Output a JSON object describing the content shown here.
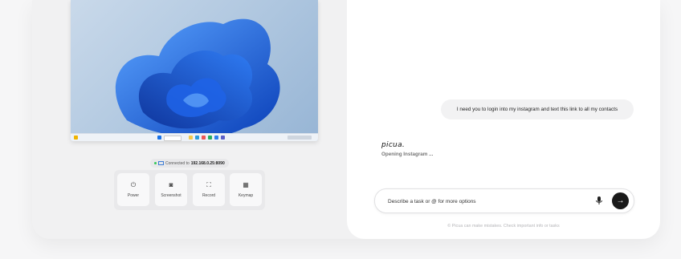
{
  "remote": {
    "connection_prefix": "Connected to",
    "ip": "192.168.0.25:8090",
    "taskbar_search": "Search"
  },
  "controls": [
    {
      "label": "Power",
      "icon": "power-icon",
      "glyph": "⏻"
    },
    {
      "label": "Screenshot",
      "icon": "camera-icon",
      "glyph": "◙"
    },
    {
      "label": "Record",
      "icon": "record-icon",
      "glyph": "⛶"
    },
    {
      "label": "Keymap",
      "icon": "keymap-icon",
      "glyph": "▦"
    }
  ],
  "chat": {
    "user_message": "I need you to login into my instagram and text this link to all my contacts",
    "assistant_name": "picua.",
    "assistant_status": "Opening Instagram ..."
  },
  "composer": {
    "placeholder": "Describe a task or @ for more options"
  },
  "footer": {
    "disclaimer": "© Picua can make mistakes. Check important info or tasks"
  },
  "colors": {
    "accent": "#1a1a1a",
    "wallpaper_blue": "#1a5fe0",
    "connected": "#34c759"
  }
}
